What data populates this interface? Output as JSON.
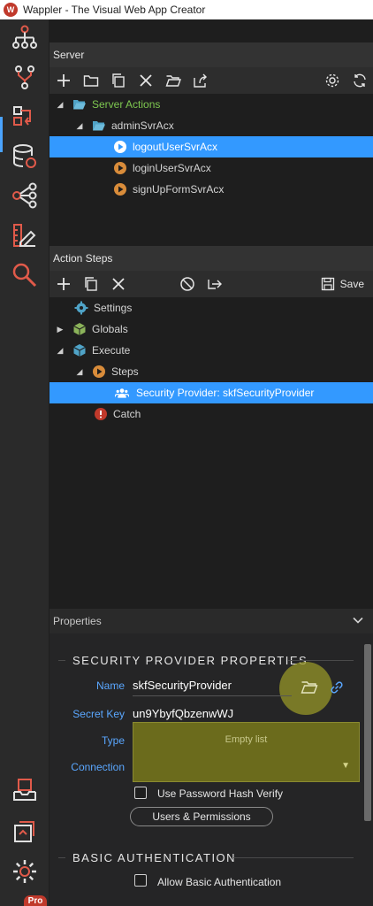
{
  "window": {
    "title": "Wappler - The Visual Web App Creator",
    "logo_text": "W"
  },
  "server_panel": {
    "title": "Server",
    "tree": [
      {
        "label": "Server Actions",
        "color": "#7ec850"
      },
      {
        "label": "adminSvrAcx"
      },
      {
        "label": "logoutUserSvrAcx",
        "selected": true
      },
      {
        "label": "loginUserSvrAcx"
      },
      {
        "label": "signUpFormSvrAcx"
      }
    ]
  },
  "steps_panel": {
    "title": "Action Steps",
    "save_label": "Save",
    "tree": [
      {
        "label": "Settings"
      },
      {
        "label": "Globals"
      },
      {
        "label": "Execute"
      },
      {
        "label": "Steps"
      },
      {
        "label": "Security Provider: skfSecurityProvider",
        "selected": true
      },
      {
        "label": "Catch"
      }
    ]
  },
  "properties": {
    "title": "Properties",
    "section1": "SECURITY PROVIDER PROPERTIES",
    "name_label": "Name",
    "name_value": "skfSecurityProvider",
    "secret_label": "Secret Key",
    "secret_value": "un9YbyfQbzenwWJ",
    "type_label": "Type",
    "type_empty": "Empty list",
    "connection_label": "Connection",
    "hash_label": "Use Password Hash Verify",
    "users_button": "Users & Permissions",
    "section2": "BASIC AUTHENTICATION",
    "basic_label": "Allow Basic Authentication"
  },
  "sidebar_badge": "Pro",
  "colors": {
    "accent": "#3399ff",
    "folder": "#4fa3c7",
    "action": "#d98c3a",
    "label_blue": "#5aa7ff",
    "highlight": "#7a7a20"
  }
}
